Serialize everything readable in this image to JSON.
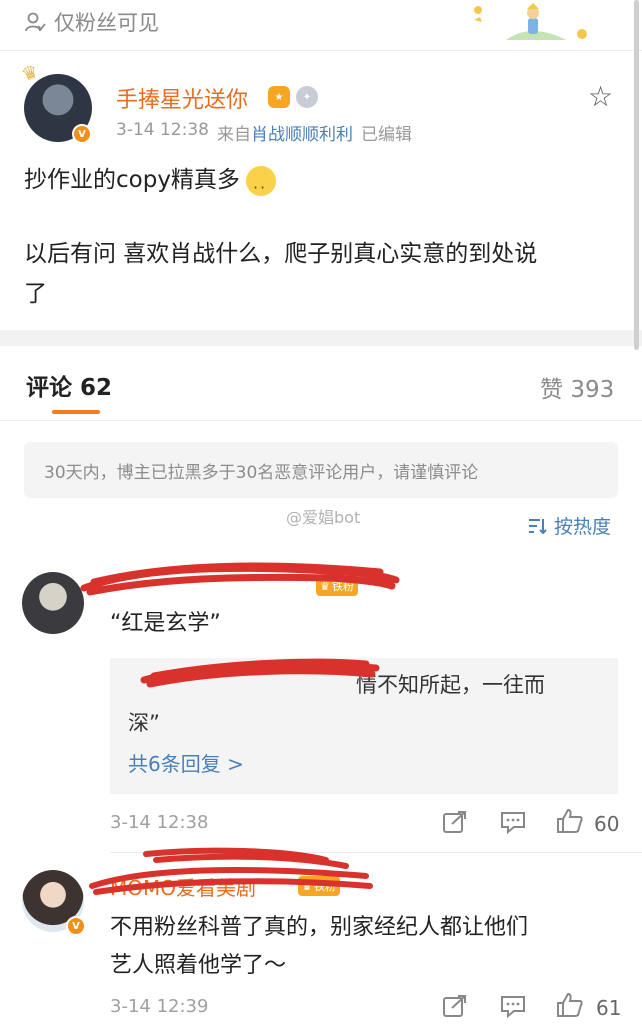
{
  "visibility": {
    "icon": "person-icon",
    "label": "仅粉丝可见"
  },
  "post": {
    "username": "手捧星光送你",
    "time": "3-14 12:38",
    "source_prefix": "来自",
    "source": "肖战顺顺利利",
    "edited": "已编辑",
    "text_line1": "抄作业的copy精真多",
    "text_line2": "以后有问 喜欢肖战什么，爬子别真心实意的到处说",
    "text_line3": "了",
    "emoji": "flushed-emoji-icon"
  },
  "tabs": {
    "comments_label": "评论",
    "comments_count": "62",
    "likes_label": "赞",
    "likes_count": "393"
  },
  "notice": "30天内，博主已拉黑多于30名恶意评论用户，请谨慎评论",
  "watermark": "@爱娼bot",
  "sort_label": "按热度",
  "comments": [
    {
      "badge": "铁粉",
      "text": "“红是玄学”",
      "reply_text_tail": "情不知所起，一往而",
      "reply_text_line2": "深”",
      "reply_more": "共6条回复 >",
      "time": "3-14 12:38",
      "likes": "60"
    },
    {
      "username": "MOMO爱看美剧",
      "badge": "铁粉",
      "text_line1": "不用粉丝科普了真的，别家经纪人都让他们",
      "text_line2": "艺人照着他学了～",
      "time": "3-14 12:39",
      "likes": "61"
    }
  ],
  "colors": {
    "accent_orange": "#f37d20",
    "username_orange": "#ea6b1e",
    "link_blue": "#4a7fb8",
    "scribble_red": "#d9312b"
  }
}
